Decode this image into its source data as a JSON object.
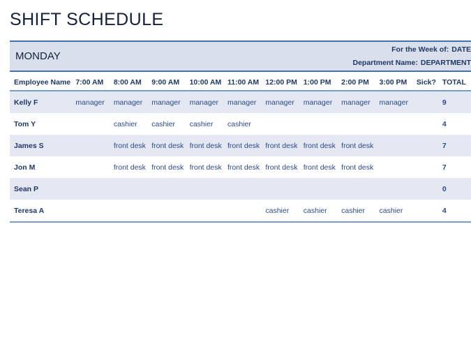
{
  "document": {
    "title": "SHIFT SCHEDULE",
    "day": "MONDAY"
  },
  "meta": {
    "week_label": "For the Week of:",
    "week_value": "DATE",
    "department_label": "Department Name:",
    "department_value": "DEPARTMENT"
  },
  "table": {
    "columns": [
      "Employee Name",
      "7:00 AM",
      "8:00 AM",
      "9:00 AM",
      "10:00 AM",
      "11:00 AM",
      "12:00 PM",
      "1:00 PM",
      "2:00 PM",
      "3:00 PM",
      "Sick?",
      "TOTAL"
    ],
    "rows": [
      {
        "name": "Kelly F",
        "slots": [
          "manager",
          "manager",
          "manager",
          "manager",
          "manager",
          "manager",
          "manager",
          "manager",
          "manager"
        ],
        "sick": "",
        "total": "9"
      },
      {
        "name": "Tom Y",
        "slots": [
          "",
          "cashier",
          "cashier",
          "cashier",
          "cashier",
          "",
          "",
          "",
          ""
        ],
        "sick": "",
        "total": "4"
      },
      {
        "name": "James S",
        "slots": [
          "",
          "front desk",
          "front desk",
          "front desk",
          "front desk",
          "front desk",
          "front desk",
          "front desk",
          ""
        ],
        "sick": "",
        "total": "7"
      },
      {
        "name": "Jon M",
        "slots": [
          "",
          "front desk",
          "front desk",
          "front desk",
          "front desk",
          "front desk",
          "front desk",
          "front desk",
          ""
        ],
        "sick": "",
        "total": "7"
      },
      {
        "name": "Sean P",
        "slots": [
          "",
          "",
          "",
          "",
          "",
          "",
          "",
          "",
          ""
        ],
        "sick": "",
        "total": "0"
      },
      {
        "name": "Teresa A",
        "slots": [
          "",
          "",
          "",
          "",
          "",
          "cashier",
          "cashier",
          "cashier",
          "cashier"
        ],
        "sick": "",
        "total": "4"
      }
    ]
  },
  "colors": {
    "banner_background": "#d9dfeb",
    "banner_border": "#4472a8",
    "row_shaded": "#e3e8f2",
    "header_text": "#1f3864",
    "cell_text": "#2a4a86",
    "title_text": "#12223f",
    "total_text": "#c0504d"
  }
}
